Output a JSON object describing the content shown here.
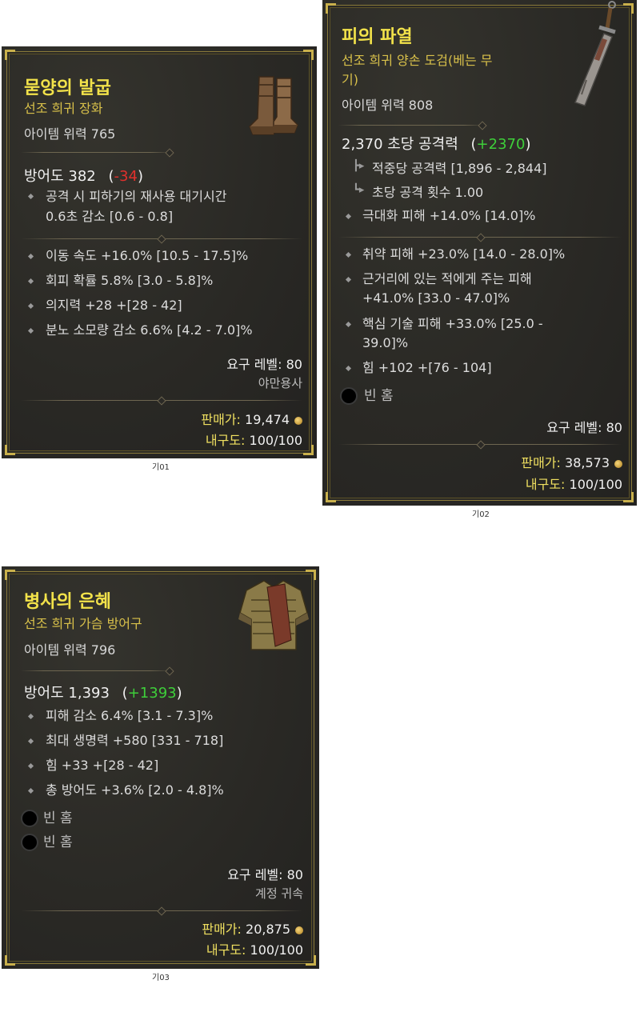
{
  "card1": {
    "name": "묻양의 발굽",
    "type": "선조 희귀 장화",
    "power": "아이템 위력 765",
    "main_stat_label": "방어도 382",
    "main_stat_delta": "-34",
    "implicit_line1": "공격 시 피하기의 재사용 대기시간",
    "implicit_line2": "0.6초 감소 [0.6 - 0.8]",
    "affixes": [
      "이동 속도 +16.0% [10.5 - 17.5]%",
      "회피 확률 5.8% [3.0 - 5.8]%",
      "의지력 +28 +[28 - 42]",
      "분노 소모량 감소 6.6% [4.2 - 7.0]%"
    ],
    "req_level": "요구 레벨: 80",
    "class": "야만용사",
    "sell_label": "판매가:",
    "sell_value": "19,474",
    "durability_label": "내구도:",
    "durability_value": "100/100",
    "caption": "기01"
  },
  "card2": {
    "name": "피의 파열",
    "type_line1": "선조 희귀 양손 도검(베는 무",
    "type_line2": "기)",
    "power": "아이템 위력 808",
    "main_stat_label": "2,370 초당 공격력",
    "main_stat_delta": "+2370",
    "sub1": "적중당 공격력 [1,896 - 2,844]",
    "sub2": "초당 공격 횟수 1.00",
    "implicit": "극대화 피해 +14.0% [14.0]%",
    "affix1": "취약 피해 +23.0% [14.0 - 28.0]%",
    "affix2a": "근거리에 있는 적에게 주는 피해",
    "affix2b": "+41.0% [33.0 - 47.0]%",
    "affix3a": "핵심 기술 피해 +33.0% [25.0 -",
    "affix3b": "39.0]%",
    "affix4": "힘 +102 +[76 - 104]",
    "socket": "빈 홈",
    "req_level": "요구 레벨: 80",
    "sell_label": "판매가:",
    "sell_value": "38,573",
    "durability_label": "내구도:",
    "durability_value": "100/100",
    "caption": "기02"
  },
  "card3": {
    "name": "병사의 은혜",
    "type": "선조 희귀 가슴 방어구",
    "power": "아이템 위력 796",
    "main_stat_label": "방어도 1,393",
    "main_stat_delta": "+1393",
    "affixes": [
      "피해 감소 6.4% [3.1 - 7.3]%",
      "최대 생명력 +580 [331 - 718]",
      "힘 +33 +[28 - 42]",
      "총 방어도 +3.6% [2.0 - 4.8]%"
    ],
    "socket1": "빈 홈",
    "socket2": "빈 홈",
    "req_level": "요구 레벨: 80",
    "binding": "계정 귀속",
    "sell_label": "판매가:",
    "sell_value": "20,875",
    "durability_label": "내구도:",
    "durability_value": "100/100",
    "caption": "기03"
  }
}
